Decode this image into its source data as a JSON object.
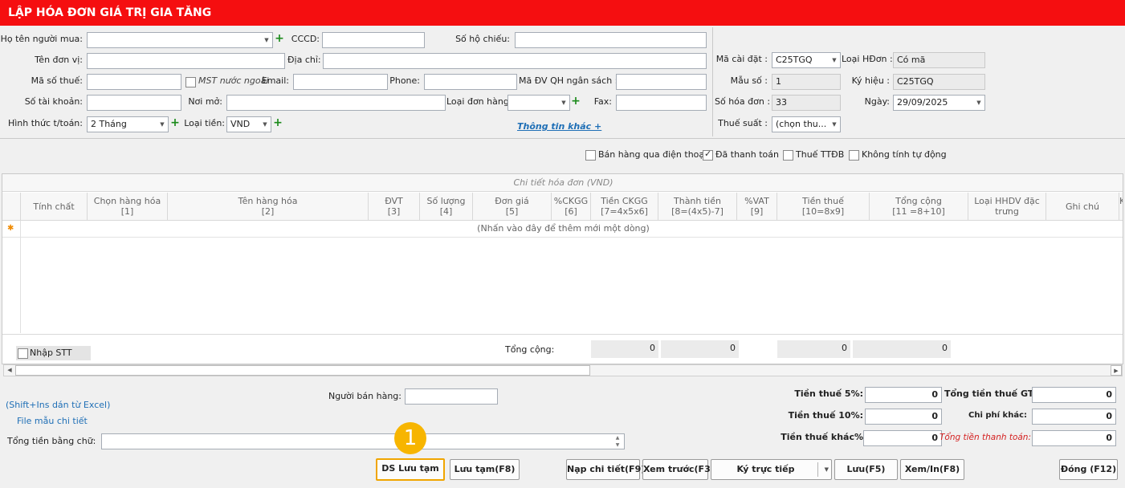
{
  "window": {
    "title": "LẬP HÓA ĐƠN GIÁ TRỊ GIA TĂNG"
  },
  "buyer": {
    "name_label": "Họ tên người mua:",
    "cccd_label": "CCCD:",
    "passport_label": "Số hộ chiếu:",
    "unit_label": "Tên đơn vị:",
    "address_label": "Địa chỉ:",
    "tax_code_label": "Mã số thuế:",
    "foreign_mst_label": "MST nước ngoài",
    "email_label": "Email:",
    "phone_label": "Phone:",
    "budget_unit_label": "Mã ĐV QH ngân sách :",
    "account_label": "Số tài khoản:",
    "bank_label": "Nơi mở:",
    "order_type_label": "Loại đơn hàng:",
    "fax_label": "Fax:",
    "payment_label": "Hình thức t/toán:",
    "payment_value": "2 Tháng",
    "currency_label": "Loại tiền:",
    "currency_value": "VND",
    "more_info_link": "Thông tin khác +"
  },
  "invoice": {
    "setup_code_label": "Mã cài đặt :",
    "setup_code_value": "C25TGQ",
    "invoice_type_label": "Loại HĐơn :",
    "invoice_type_value": "Có mã",
    "template_label": "Mẫu số :",
    "template_value": "1",
    "symbol_label": "Ký hiệu :",
    "symbol_value": "C25TGQ",
    "number_label": "Số hóa đơn :",
    "number_value": "33",
    "date_label": "Ngày:",
    "date_value": "29/09/2025",
    "tax_rate_label": "Thuế suất :",
    "tax_rate_value": "(chọn thu..."
  },
  "options": {
    "phone_sale": "Bán hàng qua điện thoại",
    "paid": "Đã thanh toán",
    "special_tax": "Thuế TTĐB",
    "no_auto_calc": "Không tính tự động"
  },
  "grid": {
    "caption": "Chi tiết hóa đơn (VND)",
    "columns": [
      {
        "l1": "Tính chất",
        "l2": ""
      },
      {
        "l1": "Chọn hàng hóa",
        "l2": "[1]"
      },
      {
        "l1": "Tên hàng hóa",
        "l2": "[2]"
      },
      {
        "l1": "ĐVT",
        "l2": "[3]"
      },
      {
        "l1": "Số lượng",
        "l2": "[4]"
      },
      {
        "l1": "Đơn giá",
        "l2": "[5]"
      },
      {
        "l1": "%CKGG",
        "l2": "[6]"
      },
      {
        "l1": "Tiền CKGG",
        "l2": "[7=4x5x6]"
      },
      {
        "l1": "Thành tiền",
        "l2": "[8=(4x5)-7]"
      },
      {
        "l1": "%VAT",
        "l2": "[9]"
      },
      {
        "l1": "Tiền thuế",
        "l2": "[10=8x9]"
      },
      {
        "l1": "Tổng cộng",
        "l2": "[11 =8+10]"
      },
      {
        "l1": "Loại HHDV đặc",
        "l2": "trưng"
      },
      {
        "l1": "Ghi chú",
        "l2": ""
      },
      {
        "l1": "Không",
        "l2": "kh"
      }
    ],
    "new_row_marker": "✱",
    "new_row_hint": "(Nhấn vào đây để thêm mới một dòng)"
  },
  "footer_grid": {
    "stt_label": "Nhập STT",
    "total_label": "Tổng cộng:",
    "total_discount": "0",
    "total_amount": "0",
    "total_tax": "0",
    "total_sum": "0"
  },
  "bottom": {
    "excel_hint": "(Shift+Ins dán từ Excel)",
    "template_link": "File mẫu chi tiết",
    "seller_label": "Người bán hàng:",
    "amount_words_label": "Tổng tiền bằng chữ:",
    "tax5_label": "Tiền thuế 5%:",
    "tax5_value": "0",
    "tax10_label": "Tiền thuế 10%:",
    "tax10_value": "0",
    "tax_other_label": "Tiền thuế khác%",
    "tax_other_value": "0",
    "total_vat_label": "Tổng tiền thuế GTGT",
    "total_vat_value": "0",
    "other_cost_label": "Chi phí khác:",
    "other_cost_value": "0",
    "grand_total_label": "Tổng tiền thanh toán:",
    "grand_total_value": "0"
  },
  "buttons": {
    "draft_list": "DS Lưu tạm",
    "save_draft": "Lưu tạm(F8)",
    "load_detail": "Nạp chi tiết(F9)",
    "preview": "Xem trước(F3)",
    "sign_direct": "Ký trực tiếp",
    "save": "Lưu(F5)",
    "view_print": "Xem/In(F8)",
    "close": "Đóng (F12)"
  },
  "marker": {
    "number": "1"
  },
  "colors": {
    "title_bg": "#f50e10",
    "marker": "#f7b500",
    "link": "#1f6fb6"
  }
}
